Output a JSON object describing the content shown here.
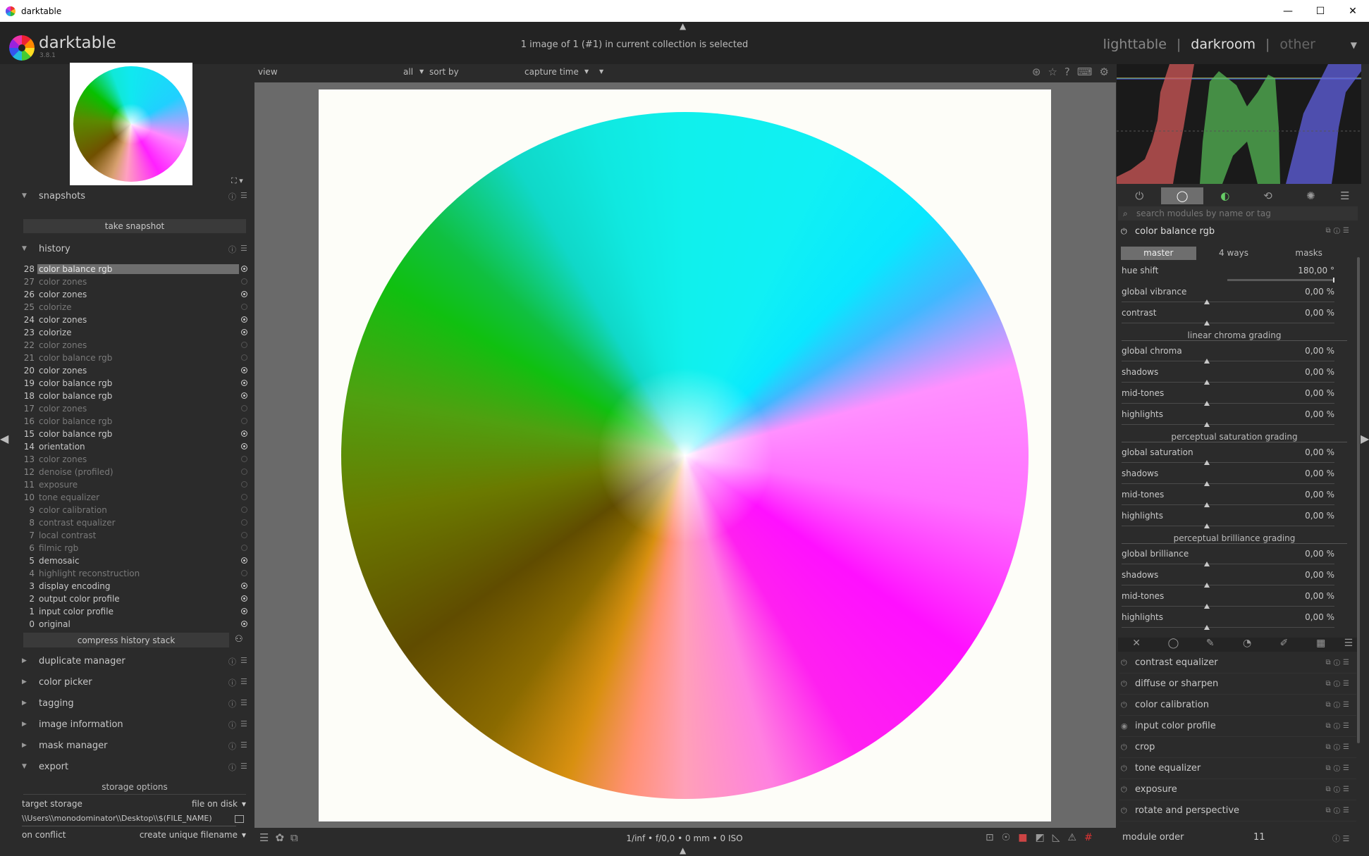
{
  "window": {
    "title": "darktable",
    "min": "—",
    "max": "☐",
    "close": "✕"
  },
  "header": {
    "logo": "darktable",
    "version": "3.8.1",
    "selection_info": "1 image of 1 (#1) in current collection is selected",
    "views": {
      "lighttable": "lighttable",
      "darkroom": "darkroom",
      "other": "other",
      "sep": "|"
    }
  },
  "filmstrip_bar": {
    "view": "view",
    "all": "all",
    "sort_by": "sort by",
    "capture_time": "capture time"
  },
  "snapshots": {
    "title": "snapshots",
    "take": "take snapshot"
  },
  "history": {
    "title": "history",
    "items": [
      {
        "n": "28",
        "name": "color balance rgb",
        "on": true,
        "off": false
      },
      {
        "n": "27",
        "name": "color zones",
        "on": false,
        "off": true
      },
      {
        "n": "26",
        "name": "color zones",
        "on": true,
        "off": false
      },
      {
        "n": "25",
        "name": "colorize",
        "on": false,
        "off": true
      },
      {
        "n": "24",
        "name": "color zones",
        "on": true,
        "off": false
      },
      {
        "n": "23",
        "name": "colorize",
        "on": true,
        "off": false
      },
      {
        "n": "22",
        "name": "color zones",
        "on": false,
        "off": true
      },
      {
        "n": "21",
        "name": "color balance rgb",
        "on": false,
        "off": true
      },
      {
        "n": "20",
        "name": "color zones",
        "on": true,
        "off": false
      },
      {
        "n": "19",
        "name": "color balance rgb",
        "on": true,
        "off": false
      },
      {
        "n": "18",
        "name": "color balance rgb",
        "on": true,
        "off": false
      },
      {
        "n": "17",
        "name": "color zones",
        "on": false,
        "off": true
      },
      {
        "n": "16",
        "name": "color balance rgb",
        "on": false,
        "off": true
      },
      {
        "n": "15",
        "name": "color balance rgb",
        "on": true,
        "off": false
      },
      {
        "n": "14",
        "name": "orientation",
        "on": true,
        "off": false
      },
      {
        "n": "13",
        "name": "color zones",
        "on": false,
        "off": true
      },
      {
        "n": "12",
        "name": "denoise (profiled)",
        "on": false,
        "off": true
      },
      {
        "n": "11",
        "name": "exposure",
        "on": false,
        "off": true
      },
      {
        "n": "10",
        "name": "tone equalizer",
        "on": false,
        "off": true
      },
      {
        "n": "9",
        "name": "color calibration",
        "on": false,
        "off": true
      },
      {
        "n": "8",
        "name": "contrast equalizer",
        "on": false,
        "off": true
      },
      {
        "n": "7",
        "name": "local contrast",
        "on": false,
        "off": true
      },
      {
        "n": "6",
        "name": "filmic rgb",
        "on": false,
        "off": true
      },
      {
        "n": "5",
        "name": "demosaic",
        "on": true,
        "off": false
      },
      {
        "n": "4",
        "name": "highlight reconstruction",
        "on": false,
        "off": true
      },
      {
        "n": "3",
        "name": "display encoding",
        "on": true,
        "off": false
      },
      {
        "n": "2",
        "name": "output color profile",
        "on": true,
        "off": false
      },
      {
        "n": "1",
        "name": "input color profile",
        "on": true,
        "off": false
      },
      {
        "n": "0",
        "name": "original",
        "on": true,
        "off": false
      }
    ],
    "compress": "compress history stack"
  },
  "left_modules": [
    "duplicate manager",
    "color picker",
    "tagging",
    "image information",
    "mask manager",
    "export"
  ],
  "export": {
    "storage_options": "storage options",
    "target_storage_label": "target storage",
    "target_storage_value": "file on disk",
    "path": "\\\\Users\\\\monodominator\\\\Desktop\\\\$(FILE_NAME)",
    "on_conflict_label": "on conflict",
    "on_conflict_value": "create unique filename"
  },
  "bottom": {
    "exif": "1/inf • f/0,0 • 0 mm • 0 ISO"
  },
  "right": {
    "search_placeholder": "search modules by name or tag",
    "module_title": "color balance rgb",
    "tabs": [
      "master",
      "4 ways",
      "masks"
    ],
    "hue_shift": {
      "label": "hue shift",
      "value": "180,00 °",
      "level": 1.0
    },
    "global_vibrance": {
      "label": "global vibrance",
      "value": "0,00 %"
    },
    "contrast": {
      "label": "contrast",
      "value": "0,00 %"
    },
    "sections": [
      "linear chroma grading",
      "perceptual saturation grading",
      "perceptual brilliance grading"
    ],
    "chroma": [
      {
        "label": "global chroma",
        "value": "0,00 %"
      },
      {
        "label": "shadows",
        "value": "0,00 %"
      },
      {
        "label": "mid-tones",
        "value": "0,00 %"
      },
      {
        "label": "highlights",
        "value": "0,00 %"
      }
    ],
    "saturation": [
      {
        "label": "global saturation",
        "value": "0,00 %"
      },
      {
        "label": "shadows",
        "value": "0,00 %"
      },
      {
        "label": "mid-tones",
        "value": "0,00 %"
      },
      {
        "label": "highlights",
        "value": "0,00 %"
      }
    ],
    "brilliance": [
      {
        "label": "global brilliance",
        "value": "0,00 %"
      },
      {
        "label": "shadows",
        "value": "0,00 %"
      },
      {
        "label": "mid-tones",
        "value": "0,00 %"
      },
      {
        "label": "highlights",
        "value": "0,00 %"
      }
    ],
    "modules": [
      "contrast equalizer",
      "diffuse or sharpen",
      "color calibration",
      "input color profile",
      "crop",
      "tone equalizer",
      "exposure",
      "rotate and perspective"
    ],
    "module_order_label": "module order",
    "module_order_value": "11"
  }
}
